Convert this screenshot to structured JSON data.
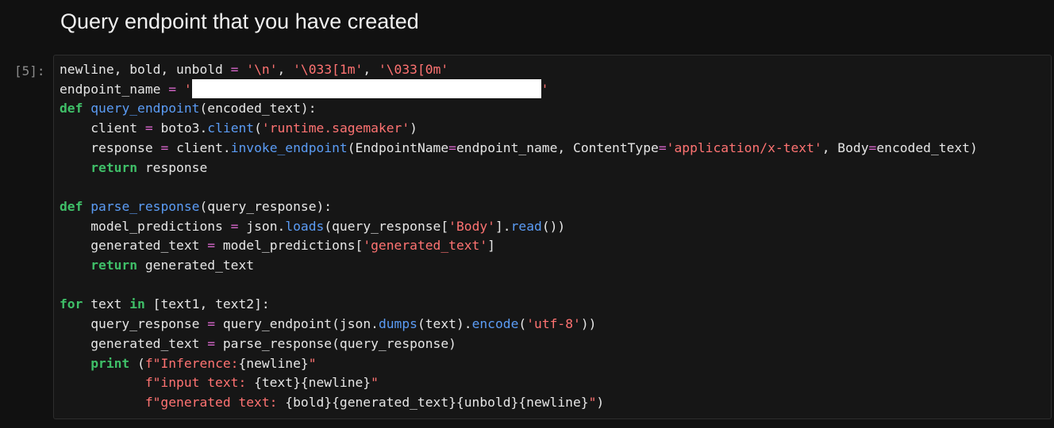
{
  "heading": "Query endpoint that you have created",
  "cell": {
    "prompt": "[5]:",
    "lines": {
      "l1": {
        "a": "newline, bold, unbold ",
        "op": "=",
        "b": " ",
        "s1": "'\\n'",
        "c1": ", ",
        "s2": "'\\033[1m'",
        "c2": ", ",
        "s3": "'\\033[0m'"
      },
      "l2": {
        "a": "endpoint_name ",
        "op": "=",
        "b": " ",
        "q1": "'",
        "q2": "'"
      },
      "l3": {
        "kw": "def",
        "sp": " ",
        "fn": "query_endpoint",
        "rest": "(encoded_text):"
      },
      "l4": {
        "ind": "    ",
        "a": "client ",
        "op": "=",
        "b": " boto3.",
        "fn": "client",
        "p1": "(",
        "s": "'runtime.sagemaker'",
        "p2": ")"
      },
      "l5": {
        "ind": "    ",
        "a": "response ",
        "op": "=",
        "b": " client.",
        "fn": "invoke_endpoint",
        "c": "(EndpointName",
        "op2": "=",
        "d": "endpoint_name, ContentType",
        "op3": "=",
        "s": "'application/x-text'",
        "e": ", Body",
        "op4": "=",
        "f": "encoded_text)"
      },
      "l6": {
        "ind": "    ",
        "kw": "return",
        "rest": " response"
      },
      "l8": {
        "kw": "def",
        "sp": " ",
        "fn": "parse_response",
        "rest": "(query_response):"
      },
      "l9": {
        "ind": "    ",
        "a": "model_predictions ",
        "op": "=",
        "b": " json.",
        "fn": "loads",
        "c": "(query_response[",
        "s": "'Body'",
        "d": "].",
        "fn2": "read",
        "e": "())"
      },
      "l10": {
        "ind": "    ",
        "a": "generated_text ",
        "op": "=",
        "b": " model_predictions[",
        "s": "'generated_text'",
        "c": "]"
      },
      "l11": {
        "ind": "    ",
        "kw": "return",
        "rest": " generated_text"
      },
      "l13": {
        "kw": "for",
        "a": " text ",
        "kw2": "in",
        "b": " [text1, text2]:"
      },
      "l14": {
        "ind": "    ",
        "a": "query_response ",
        "op": "=",
        "b": " query_endpoint(json.",
        "fn": "dumps",
        "c": "(text).",
        "fn2": "encode",
        "p1": "(",
        "s": "'utf-8'",
        "p2": "))"
      },
      "l15": {
        "ind": "    ",
        "a": "generated_text ",
        "op": "=",
        "b": " parse_response(query_response)"
      },
      "l16": {
        "ind": "    ",
        "kw": "print",
        "a": " (",
        "s1": "f\"Inference:",
        "b": "{newline}",
        "s2": "\""
      },
      "l17": {
        "ind": "           ",
        "s1": "f\"input text: ",
        "b": "{text}{newline}",
        "s2": "\""
      },
      "l18": {
        "ind": "           ",
        "s1": "f\"generated text: ",
        "b": "{bold}{generated_text}{unbold}{newline}",
        "s2": "\"",
        "c": ")"
      }
    }
  },
  "colors": {
    "keyword": "#3fbf68",
    "function": "#5b9cf5",
    "string": "#ff7372",
    "operator": "#d466c8",
    "background": "#111111"
  }
}
